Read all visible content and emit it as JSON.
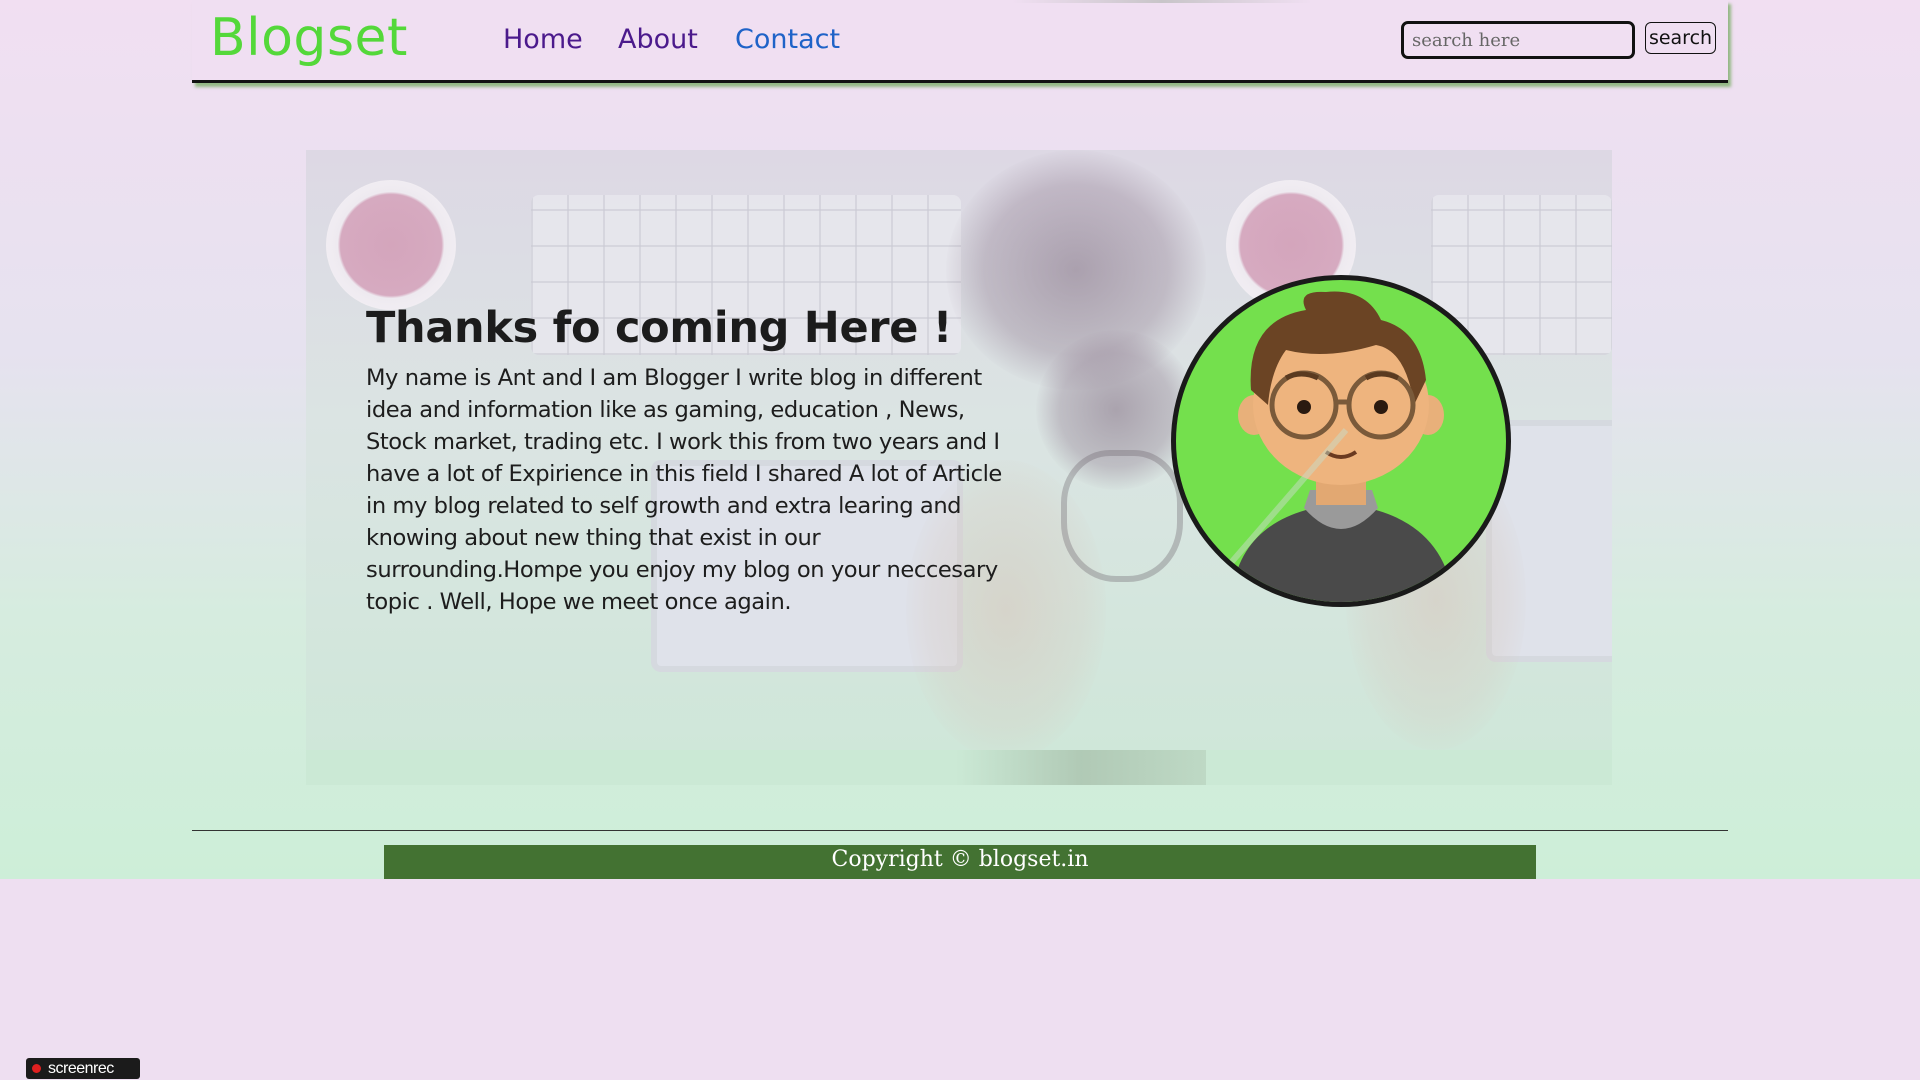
{
  "brand": {
    "name": "Blogset"
  },
  "nav": {
    "links": [
      {
        "label": "Home"
      },
      {
        "label": "About"
      },
      {
        "label": "Contact"
      }
    ]
  },
  "search": {
    "placeholder": "search here",
    "button_label": "search"
  },
  "hero": {
    "title": "Thanks fo coming Here !",
    "paragraph": "My name is Ant and I am Blogger I write blog in different idea and information like as gaming, education , News, Stock market, trading etc. I work this from two years and I have a lot of Expirience in this field I shared A lot of Article in my blog related to self growth and extra learing and knowing about new thing that exist in our surrounding.Hompe you enjoy my blog on your neccesary topic . Well, Hope we meet once again.",
    "avatar_icon": "cartoon-man-avatar-icon"
  },
  "footer": {
    "copyright": "Copyright © blogset.in"
  },
  "watermark": {
    "label": "screenrec"
  },
  "colors": {
    "brand": "#54d83a",
    "nav_home": "#4b1a8c",
    "nav_contact": "#1f63c8",
    "avatar_bg": "#74e04d",
    "footer_bg": "#437232"
  }
}
